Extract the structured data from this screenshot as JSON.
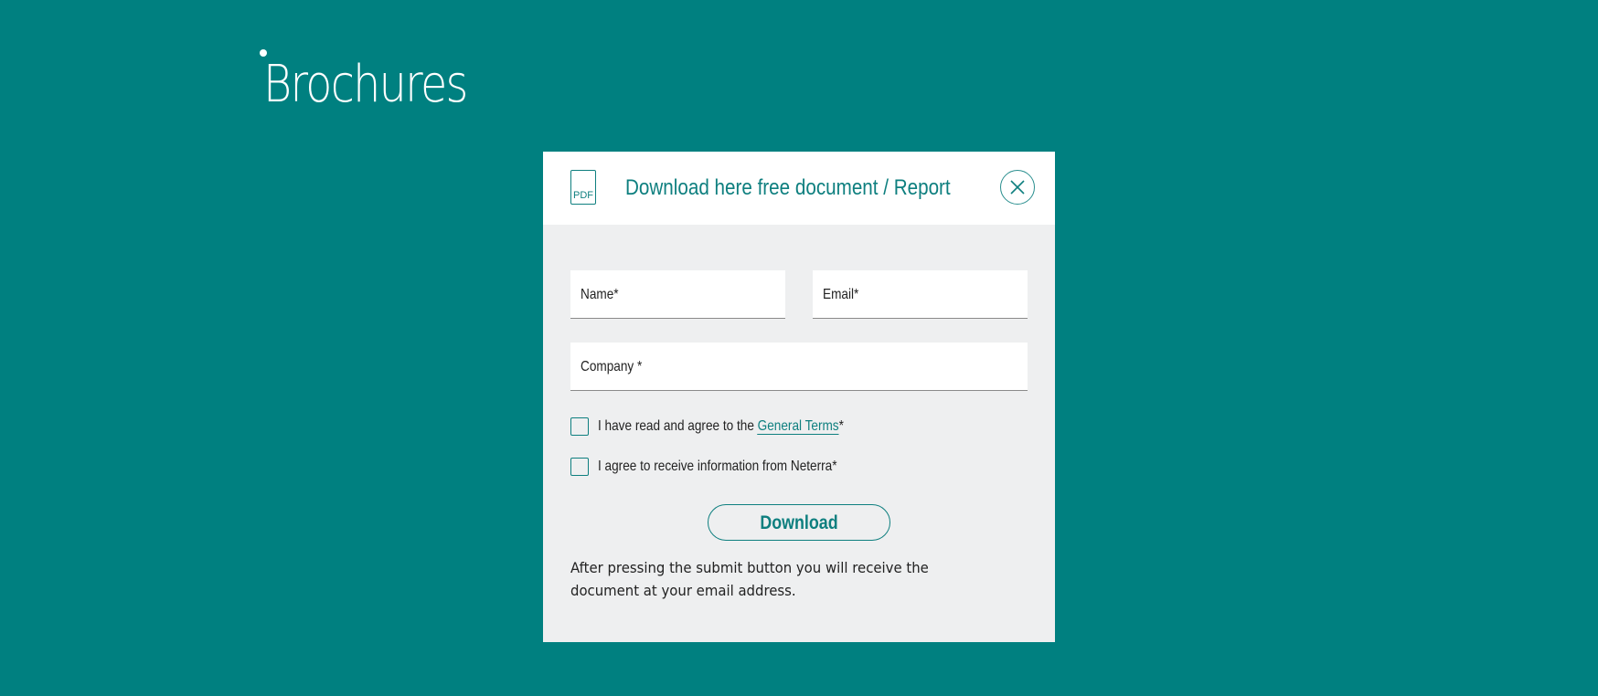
{
  "page": {
    "title": "Brochures"
  },
  "modal": {
    "pdf_icon_label": "PDF",
    "title": "Download here free document / Report",
    "fields": {
      "name_label": "Name*",
      "email_label": "Email*",
      "company_label": "Company *"
    },
    "terms": {
      "prefix": "I have read and agree to the ",
      "link": "General Terms",
      "suffix": "*",
      "checked": false
    },
    "info": {
      "text": "I agree to receive information from Neterra*",
      "checked": false
    },
    "download_label": "Download",
    "note": "After pressing the submit button you will receive the document at your email address."
  },
  "colors": {
    "background": "#008080",
    "modal_body": "#eeeff0",
    "accent": "#0e7f7f"
  },
  "icons": [
    "pdf-file-icon",
    "close-icon"
  ]
}
